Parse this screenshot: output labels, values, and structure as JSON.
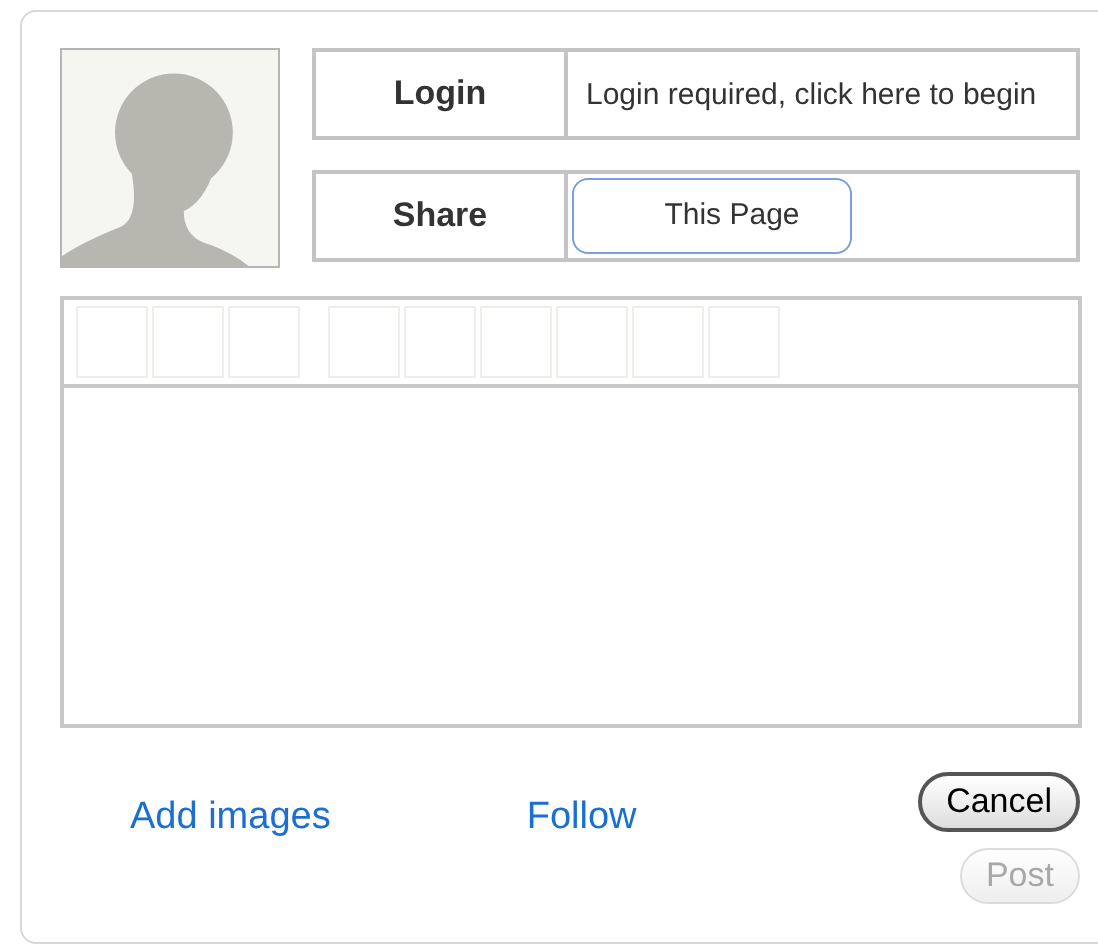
{
  "rows": [
    {
      "label": "Login",
      "kind": "text",
      "value": "Login required, click here to begin"
    },
    {
      "label": "Share",
      "kind": "button",
      "value": "This Page"
    }
  ],
  "links": [
    "Add images",
    "Follow"
  ],
  "buttons": [
    {
      "label": "Cancel",
      "disabled": false
    },
    {
      "label": "Post",
      "disabled": true
    }
  ]
}
